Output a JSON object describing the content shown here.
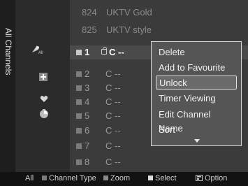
{
  "side_tab": {
    "label": "All Channels"
  },
  "top_rows": [
    {
      "number": "824",
      "name": "UKTV Gold"
    },
    {
      "number": "825",
      "name": "UKTV style"
    }
  ],
  "channels": [
    {
      "number": "1",
      "name": "C --",
      "locked": true,
      "selected": true
    },
    {
      "number": "2",
      "name": "C --"
    },
    {
      "number": "3",
      "name": "C --"
    },
    {
      "number": "4",
      "name": "C --"
    },
    {
      "number": "5",
      "name": "C --"
    },
    {
      "number": "6",
      "name": "C --"
    },
    {
      "number": "7",
      "name": "C --"
    },
    {
      "number": "8",
      "name": "C --"
    }
  ],
  "menu": {
    "items": [
      "Delete",
      "Add to Favourite",
      "Unlock",
      "Timer Viewing",
      "Edit Channel Name",
      "Sort"
    ],
    "active_index": 2
  },
  "side_icons": [
    "satellite-dish-icon",
    "add-icon",
    "heart-icon",
    "timer-icon"
  ],
  "bottom_bar": {
    "all_label": "All",
    "channel_type_label": "Channel Type",
    "zoom_label": "Zoom",
    "select_label": "Select",
    "option_label": "Option"
  },
  "colors": {
    "channel_type_key": "#7a7a7a",
    "zoom_key": "#8a8a8a",
    "select_key": "#dddddd"
  }
}
